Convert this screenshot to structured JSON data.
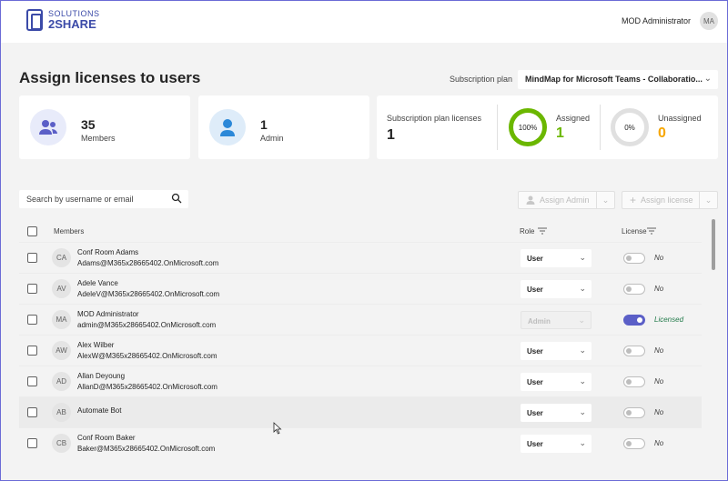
{
  "header": {
    "logo_line1": "SOLUTIONS",
    "logo_line2": "2SHARE",
    "user_name": "MOD Administrator",
    "user_initials": "MA"
  },
  "page": {
    "title": "Assign licenses to users",
    "subscription_label": "Subscription plan",
    "subscription_value": "MindMap for Microsoft Teams - Collaboratio..."
  },
  "stats": {
    "members_count": "35",
    "members_label": "Members",
    "admin_count": "1",
    "admin_label": "Admin",
    "licenses_title": "Subscription plan licenses",
    "licenses_count": "1",
    "assigned_pct": "100%",
    "assigned_label": "Assigned",
    "assigned_count": "1",
    "unassigned_pct": "0%",
    "unassigned_label": "Unassigned",
    "unassigned_count": "0"
  },
  "toolbar": {
    "search_placeholder": "Search by username or email",
    "assign_admin": "Assign Admin",
    "assign_license": "Assign license"
  },
  "table": {
    "col_members": "Members",
    "col_role": "Role",
    "col_license": "License",
    "rows": [
      {
        "initials": "CA",
        "name": "Conf Room Adams",
        "email": "Adams@M365x28665402.OnMicrosoft.com",
        "role": "User",
        "license": "No"
      },
      {
        "initials": "AV",
        "name": "Adele Vance",
        "email": "AdeleV@M365x28665402.OnMicrosoft.com",
        "role": "User",
        "license": "No"
      },
      {
        "initials": "MA",
        "name": "MOD Administrator",
        "email": "admin@M365x28665402.OnMicrosoft.com",
        "role": "Admin",
        "license": "Licensed"
      },
      {
        "initials": "AW",
        "name": "Alex Wilber",
        "email": "AlexW@M365x28665402.OnMicrosoft.com",
        "role": "User",
        "license": "No"
      },
      {
        "initials": "AD",
        "name": "Allan Deyoung",
        "email": "AllanD@M365x28665402.OnMicrosoft.com",
        "role": "User",
        "license": "No"
      },
      {
        "initials": "AB",
        "name": "Automate Bot",
        "email": "",
        "role": "User",
        "license": "No"
      },
      {
        "initials": "CB",
        "name": "Conf Room Baker",
        "email": "Baker@M365x28665402.OnMicrosoft.com",
        "role": "User",
        "license": "No"
      }
    ]
  },
  "colors": {
    "accent": "#5b5fc7",
    "assigned_green": "#6bb700",
    "unassigned_orange": "#f7a600"
  }
}
